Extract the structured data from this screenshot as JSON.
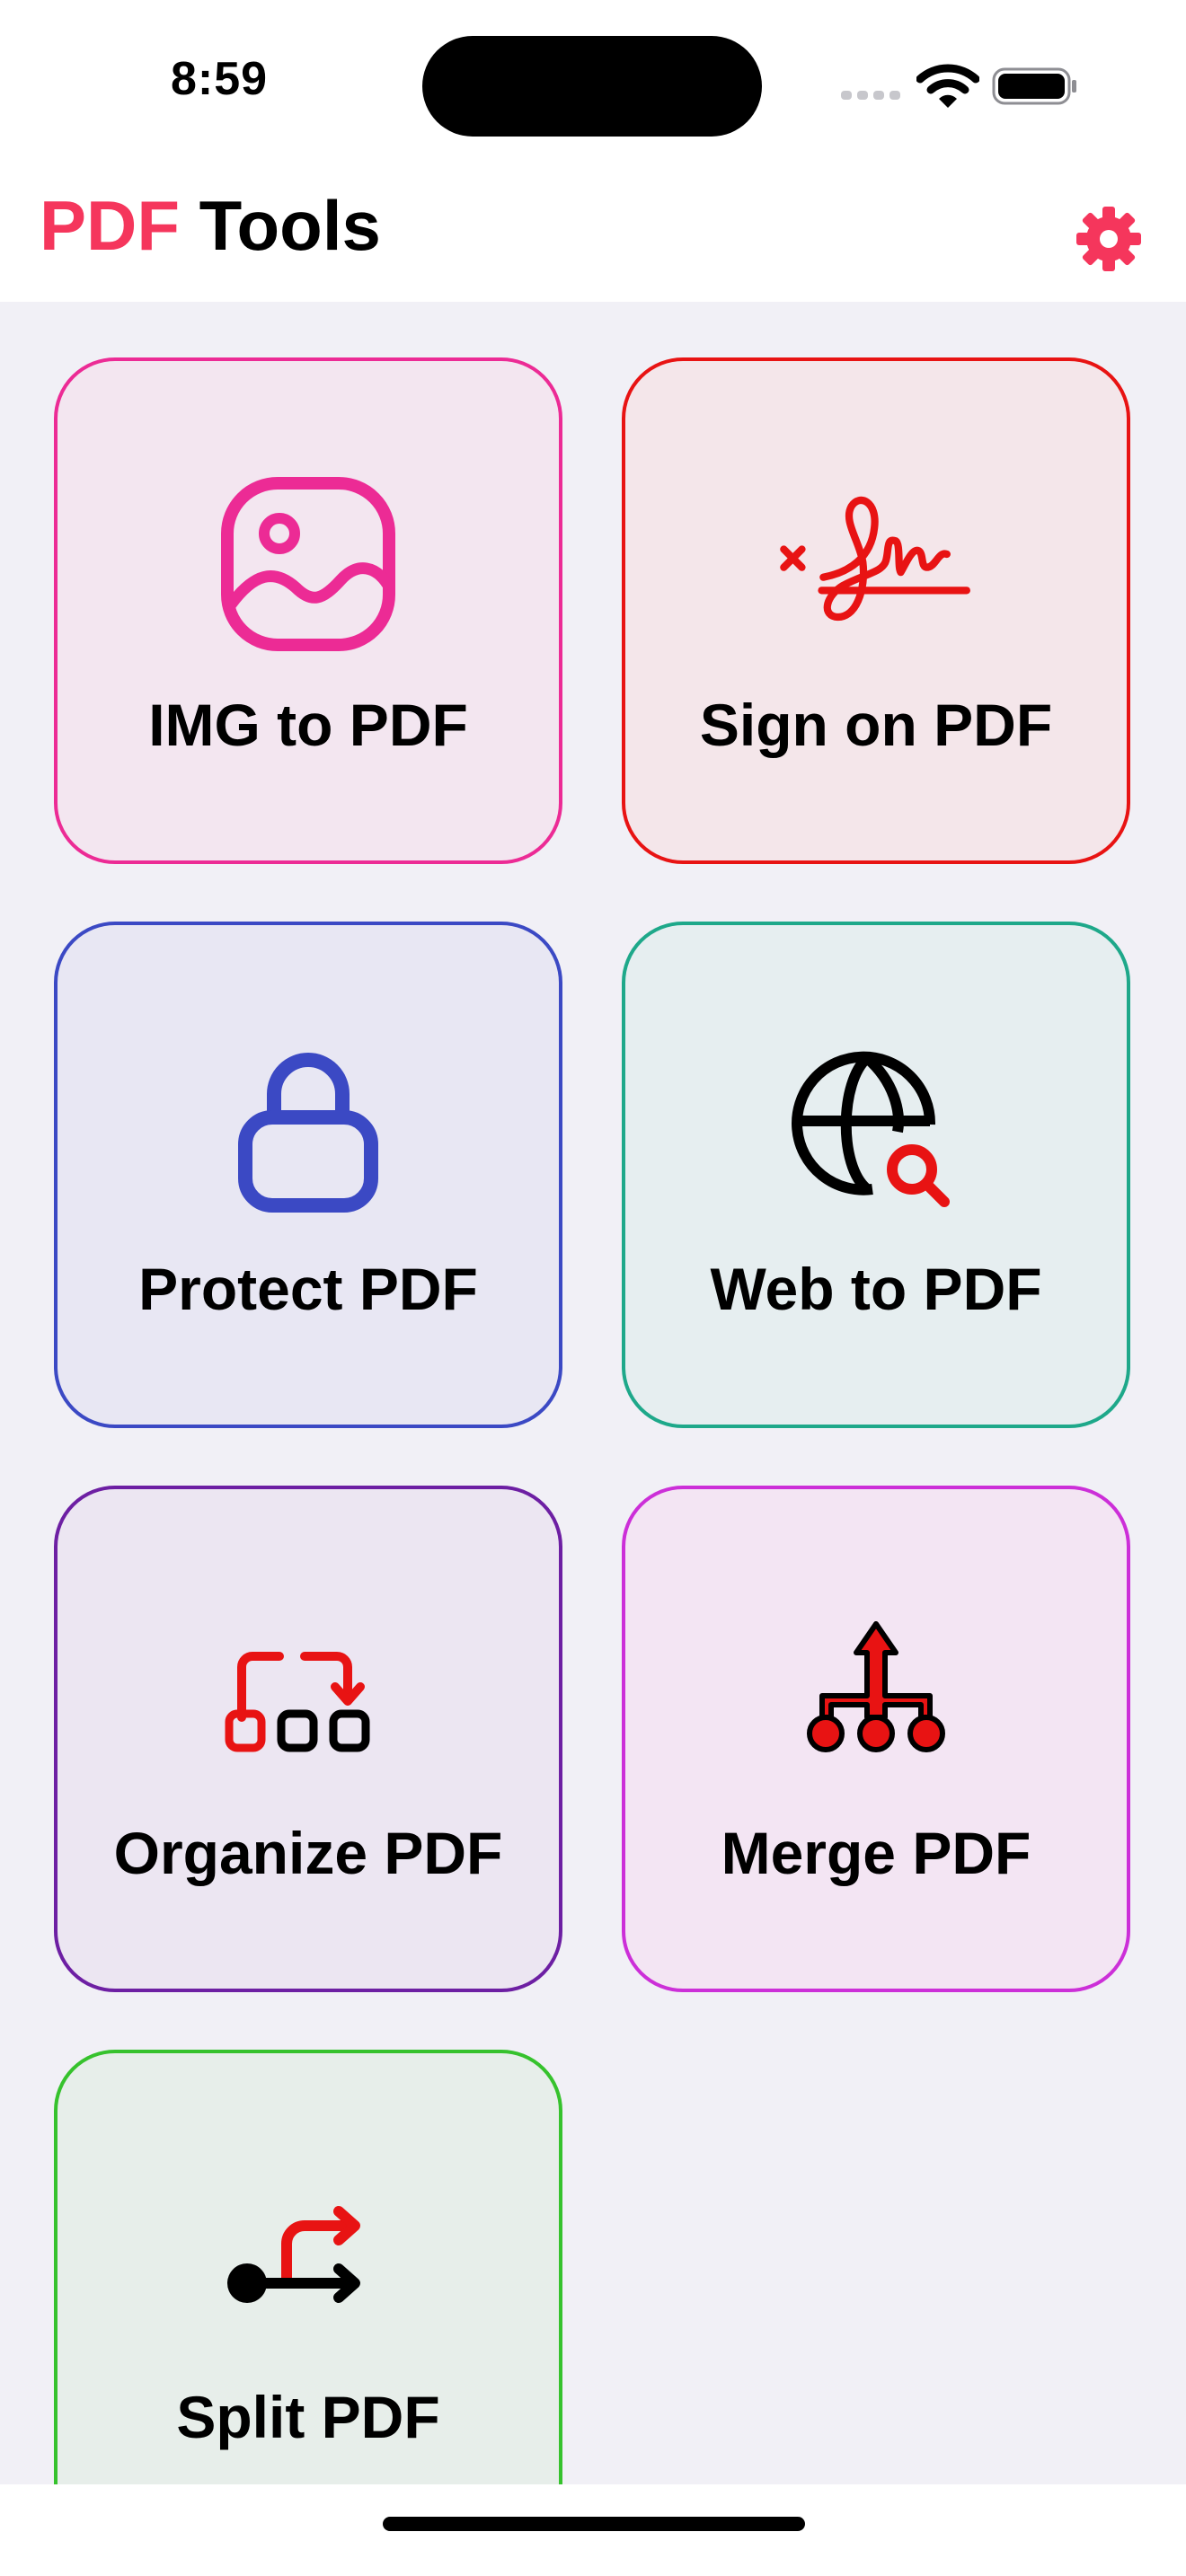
{
  "status_bar": {
    "time": "8:59"
  },
  "header": {
    "title_accent": "PDF",
    "title_rest": " Tools",
    "accent_color": "#f5365c",
    "settings_icon": "gear-icon"
  },
  "tools": [
    {
      "label": "IMG to PDF",
      "icon": "image-icon",
      "color": "#ec2b95"
    },
    {
      "label": "Sign on PDF",
      "icon": "signature-icon",
      "color": "#e81313"
    },
    {
      "label": "Protect PDF",
      "icon": "lock-icon",
      "color": "#3b49c4"
    },
    {
      "label": "Web to PDF",
      "icon": "globe-search-icon",
      "color": "#1ea88a"
    },
    {
      "label": "Organize PDF",
      "icon": "reorder-icon",
      "color": "#6d1fa3"
    },
    {
      "label": "Merge PDF",
      "icon": "merge-icon",
      "color": "#cc2fd8"
    },
    {
      "label": "Split PDF",
      "icon": "split-icon",
      "color": "#36c22d"
    }
  ]
}
